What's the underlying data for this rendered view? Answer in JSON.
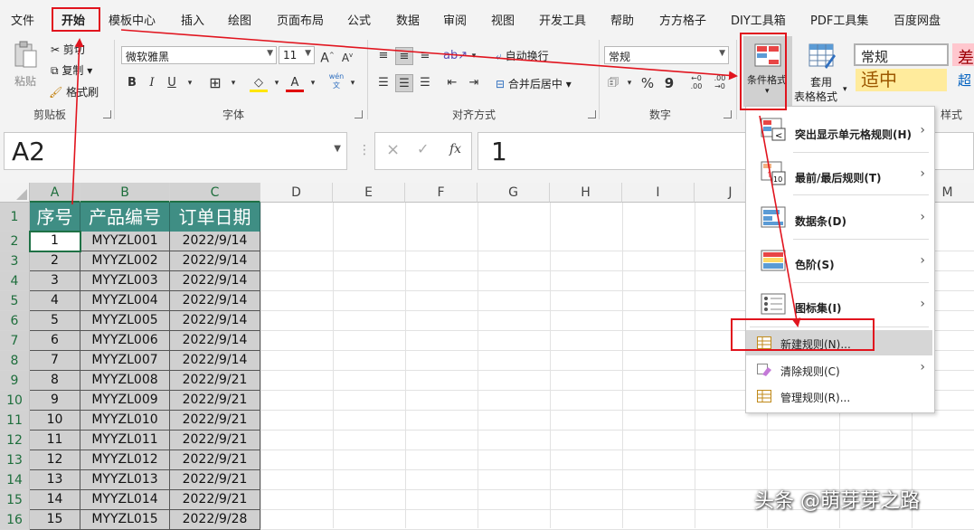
{
  "menubar": {
    "tabs": [
      "文件",
      "开始",
      "模板中心",
      "插入",
      "绘图",
      "页面布局",
      "公式",
      "数据",
      "审阅",
      "视图",
      "开发工具",
      "帮助",
      "方方格子",
      "DIY工具箱",
      "PDF工具集",
      "百度网盘"
    ],
    "active": "开始"
  },
  "ribbon": {
    "clipboard": {
      "paste": "粘贴",
      "cut": "剪切",
      "copy": "复制",
      "format_painter": "格式刷",
      "label": "剪贴板"
    },
    "font": {
      "name": "微软雅黑",
      "size": "11",
      "bold": "B",
      "italic": "I",
      "underline": "U",
      "wen": "wén",
      "label": "字体"
    },
    "alignment": {
      "wrap": "自动换行",
      "merge": "合并后居中",
      "label": "对齐方式"
    },
    "number": {
      "format": "常规",
      "percent": "%",
      "comma": "9",
      "label": "数字"
    },
    "styles": {
      "cond_format": "条件格式",
      "table_format_1": "套用",
      "table_format_2": "表格格式",
      "normal": "常规",
      "neutral": "适中",
      "bad": "差",
      "link": "超链",
      "label": "样式"
    }
  },
  "formula_bar": {
    "name_box": "A2",
    "cancel": "×",
    "enter": "✓",
    "fx": "fx",
    "content": "1"
  },
  "sheet": {
    "columns": [
      "A",
      "B",
      "C",
      "D",
      "E",
      "F",
      "G",
      "H",
      "I",
      "J",
      "K",
      "L",
      "M"
    ],
    "headers": [
      "序号",
      "产品编号",
      "订单日期"
    ],
    "rows": [
      {
        "r": "2",
        "a": "1",
        "b": "MYYZL001",
        "c": "2022/9/14"
      },
      {
        "r": "3",
        "a": "2",
        "b": "MYYZL002",
        "c": "2022/9/14"
      },
      {
        "r": "4",
        "a": "3",
        "b": "MYYZL003",
        "c": "2022/9/14"
      },
      {
        "r": "5",
        "a": "4",
        "b": "MYYZL004",
        "c": "2022/9/14"
      },
      {
        "r": "6",
        "a": "5",
        "b": "MYYZL005",
        "c": "2022/9/14"
      },
      {
        "r": "7",
        "a": "6",
        "b": "MYYZL006",
        "c": "2022/9/14"
      },
      {
        "r": "8",
        "a": "7",
        "b": "MYYZL007",
        "c": "2022/9/14"
      },
      {
        "r": "9",
        "a": "8",
        "b": "MYYZL008",
        "c": "2022/9/21"
      },
      {
        "r": "10",
        "a": "9",
        "b": "MYYZL009",
        "c": "2022/9/21"
      },
      {
        "r": "11",
        "a": "10",
        "b": "MYYZL010",
        "c": "2022/9/21"
      },
      {
        "r": "12",
        "a": "11",
        "b": "MYYZL011",
        "c": "2022/9/21"
      },
      {
        "r": "13",
        "a": "12",
        "b": "MYYZL012",
        "c": "2022/9/21"
      },
      {
        "r": "14",
        "a": "13",
        "b": "MYYZL013",
        "c": "2022/9/21"
      },
      {
        "r": "15",
        "a": "14",
        "b": "MYYZL014",
        "c": "2022/9/21"
      },
      {
        "r": "16",
        "a": "15",
        "b": "MYYZL015",
        "c": "2022/9/28"
      }
    ]
  },
  "cf_menu": {
    "items": [
      {
        "label": "突出显示单元格规则(H)"
      },
      {
        "label": "最前/最后规则(T)"
      },
      {
        "label": "数据条(D)"
      },
      {
        "label": "色阶(S)"
      },
      {
        "label": "图标集(I)"
      },
      {
        "label": "新建规则(N)..."
      },
      {
        "label": "清除规则(C)"
      },
      {
        "label": "管理规则(R)..."
      }
    ]
  },
  "colors": {
    "header_fill": "#3f8e84",
    "annotation_red": "#e1141e",
    "excel_green": "#1e7145"
  },
  "watermark": "头条 @萌芽芽之路"
}
